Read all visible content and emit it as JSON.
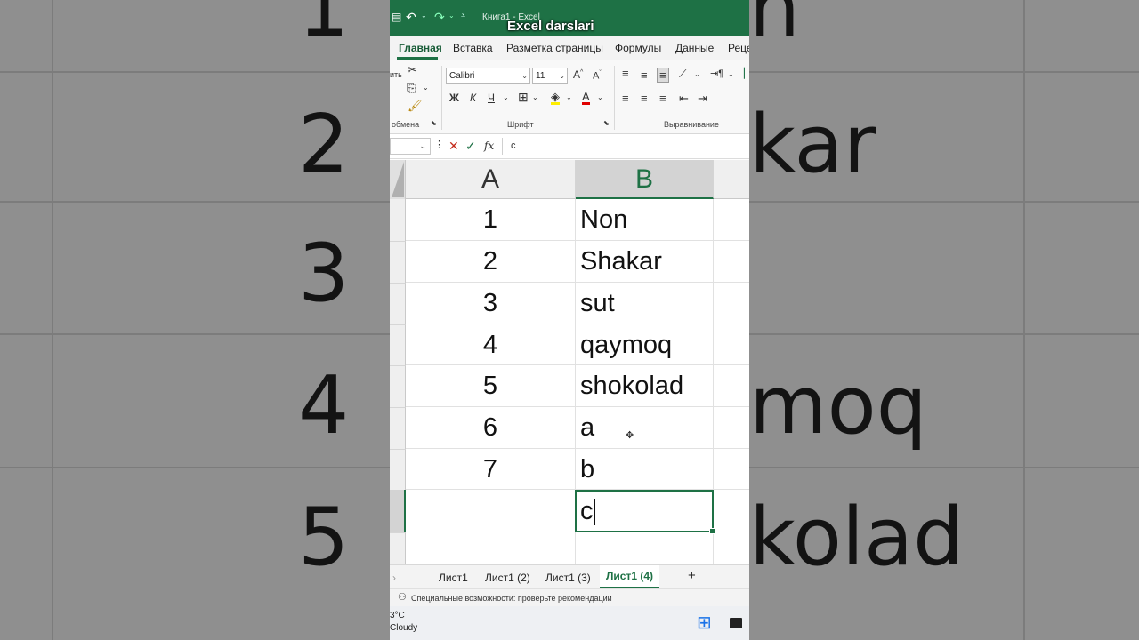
{
  "background": {
    "rows": [
      "1",
      "2",
      "3",
      "4",
      "5"
    ],
    "values": [
      "n",
      "kar",
      "moq",
      "kolad"
    ]
  },
  "titlebar": {
    "doc": "Книга1 - Excel",
    "overlay": "Excel darslari"
  },
  "tabs": [
    "Главная",
    "Вставка",
    "Разметка страницы",
    "Формулы",
    "Данные",
    "Реце"
  ],
  "ribbon": {
    "paste_label": "ить",
    "clipboard_label": "обмена",
    "font_group": "Шрифт",
    "align_group": "Выравнивание",
    "font_name": "Calibri",
    "font_size": "11",
    "bold": "Ж",
    "italic": "К",
    "underline": "Ч"
  },
  "formula_bar": {
    "fx": "fx",
    "value": "c"
  },
  "columns": [
    "A",
    "B"
  ],
  "rows": [
    {
      "a": "1",
      "b": "Non"
    },
    {
      "a": "2",
      "b": "Shakar"
    },
    {
      "a": "3",
      "b": "sut"
    },
    {
      "a": "4",
      "b": "qaymoq"
    },
    {
      "a": "5",
      "b": "shokolad"
    },
    {
      "a": "6",
      "b": "a"
    },
    {
      "a": "7",
      "b": "b"
    }
  ],
  "active_cell": {
    "value": "c"
  },
  "sheets": [
    "Лист1",
    "Лист1 (2)",
    "Лист1 (3)",
    "Лист1 (4)"
  ],
  "add_sheet": "+",
  "status": "Специальные возможности: проверьте рекомендации",
  "weather": {
    "temp": "3°C",
    "cond": "Cloudy"
  },
  "colors": {
    "excel_green": "#1e7145",
    "header_selected": "#d3d3d3"
  }
}
